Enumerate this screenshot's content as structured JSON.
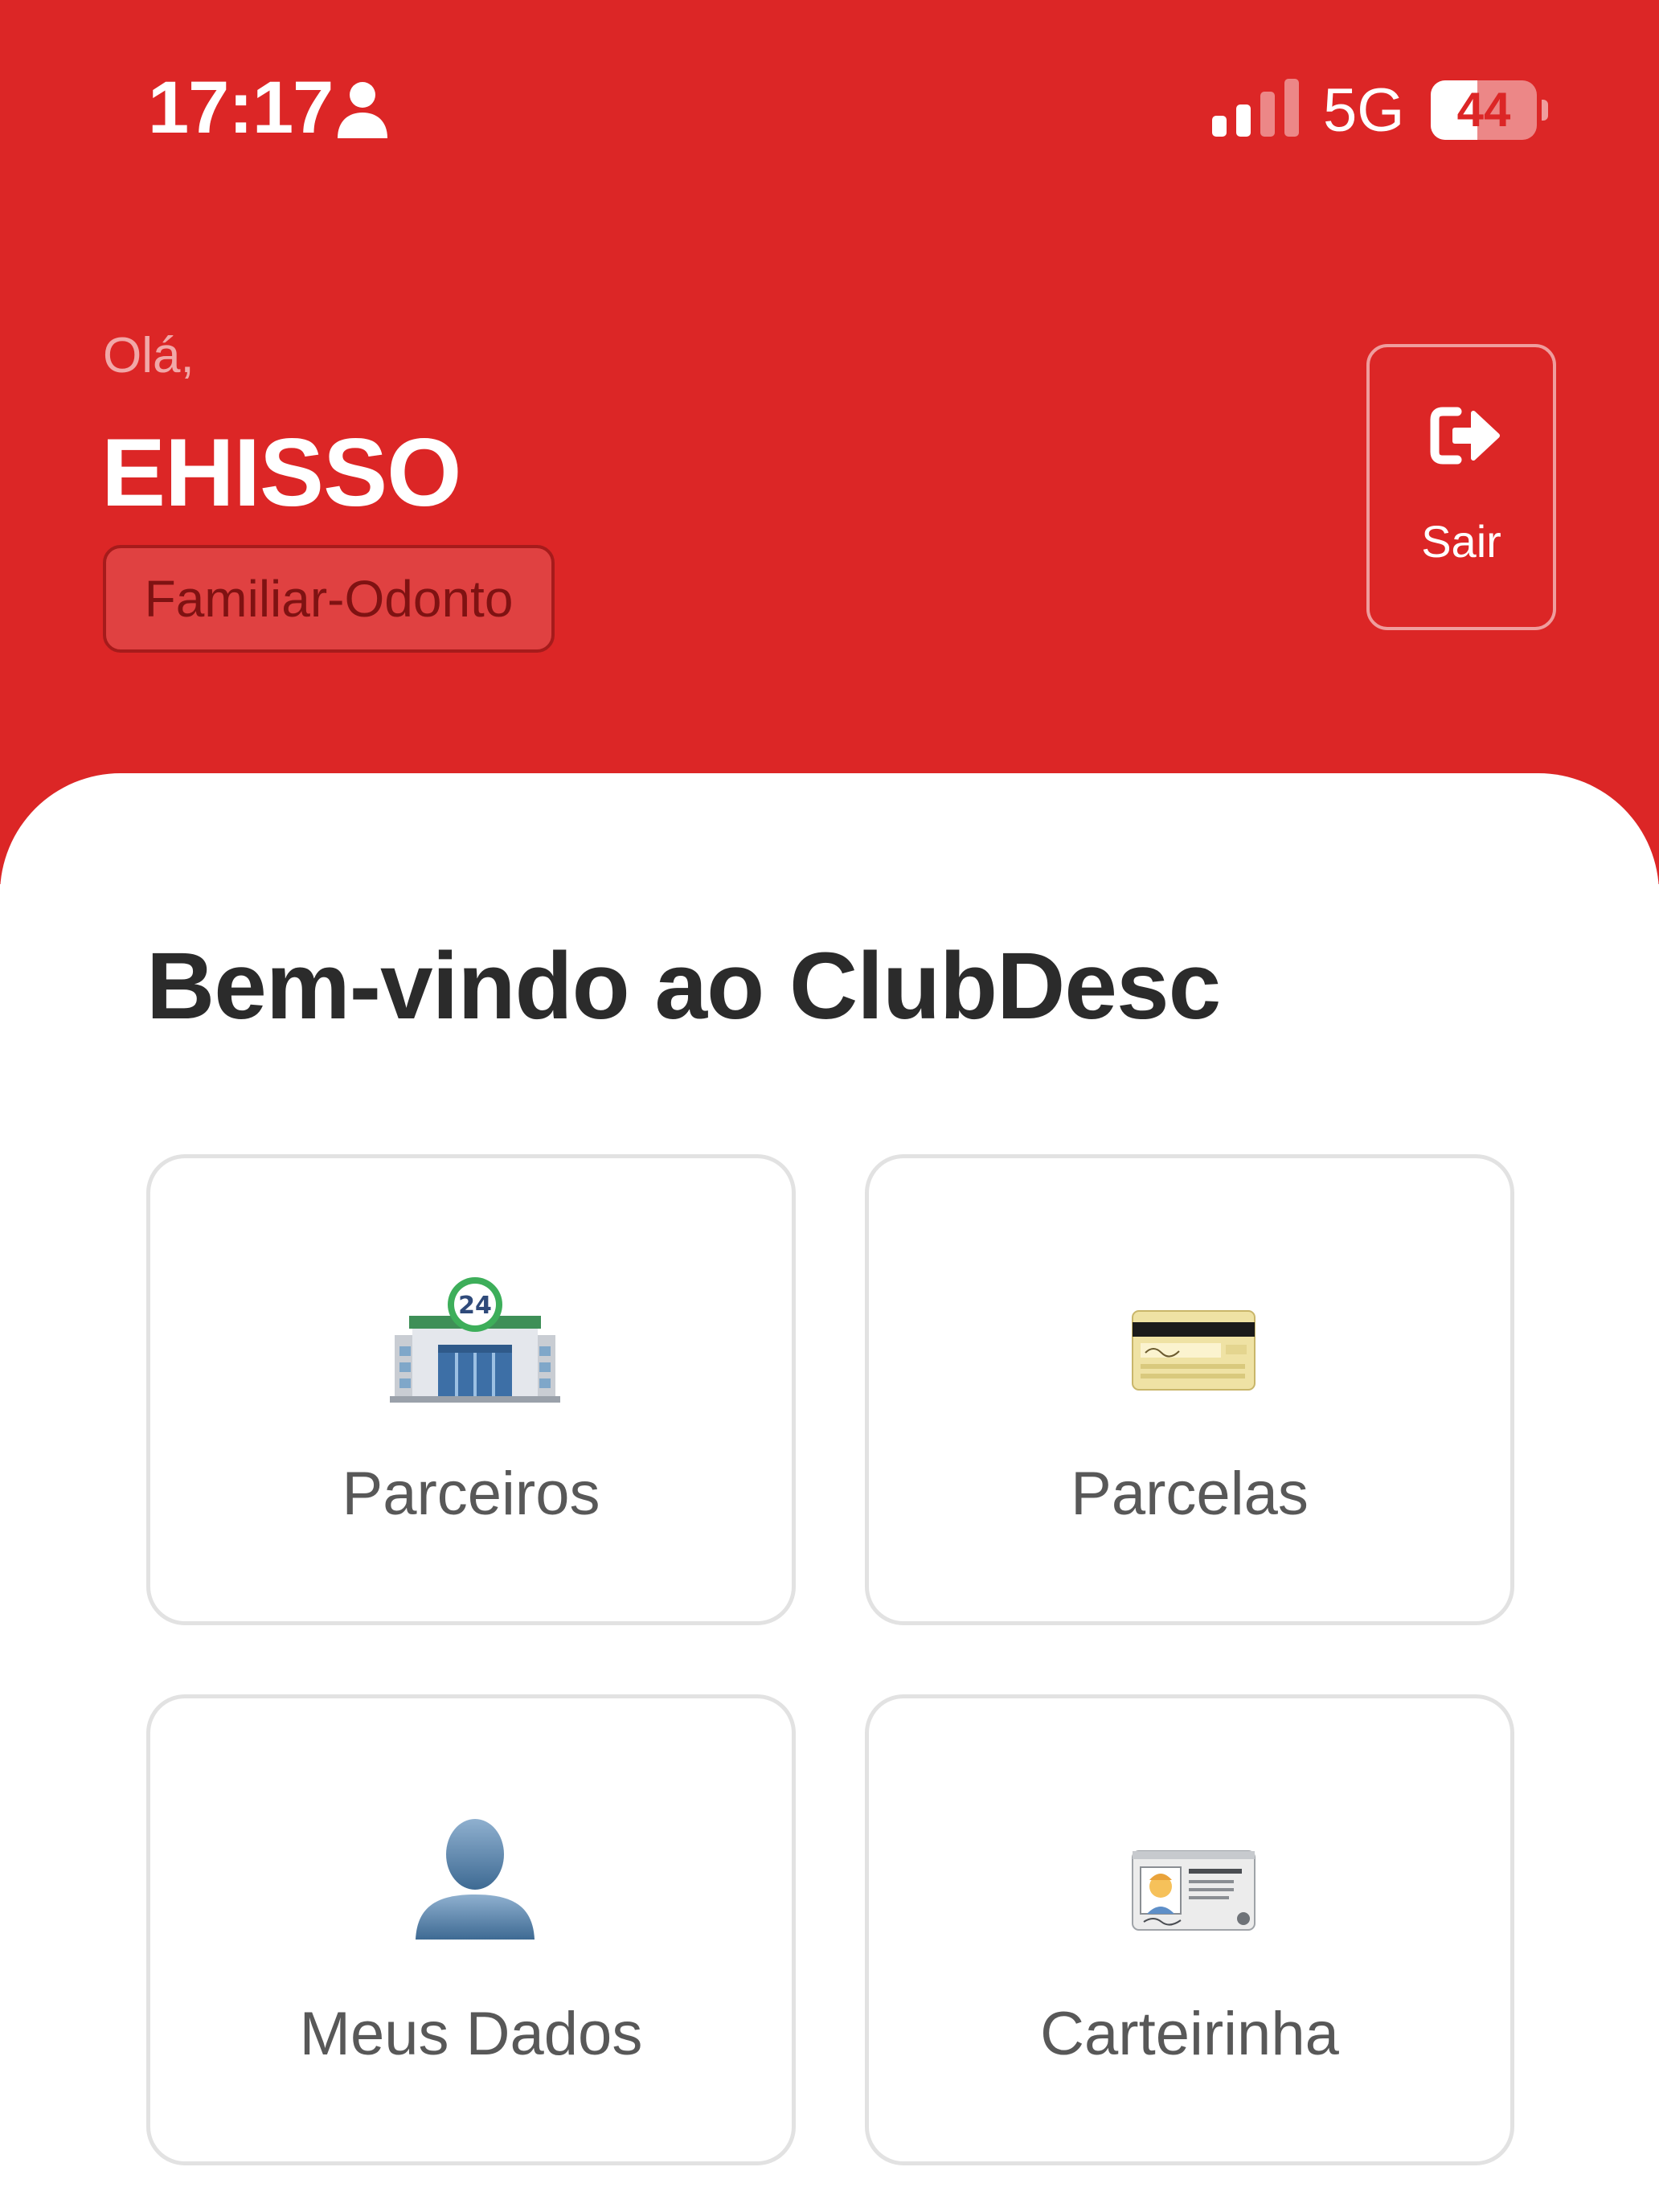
{
  "status_bar": {
    "time": "17:17",
    "network": "5G",
    "battery_level": "44",
    "battery_fraction": 0.44
  },
  "header": {
    "greeting": "Olá,",
    "user_name": "EHISSO",
    "plan": "Familiar-Odonto",
    "logout_label": "Sair"
  },
  "main": {
    "title": "Bem-vindo ao ClubDesc",
    "cards": [
      {
        "label": "Parceiros",
        "icon": "convenience-store-icon"
      },
      {
        "label": "Parcelas",
        "icon": "credit-card-icon"
      },
      {
        "label": "Meus Dados",
        "icon": "user-silhouette-icon"
      },
      {
        "label": "Carteirinha",
        "icon": "id-card-icon"
      }
    ]
  },
  "colors": {
    "brand_red": "#DC2626",
    "card_border": "#E2E2E2",
    "title_text": "#2B2B2B",
    "card_text": "#585858"
  }
}
